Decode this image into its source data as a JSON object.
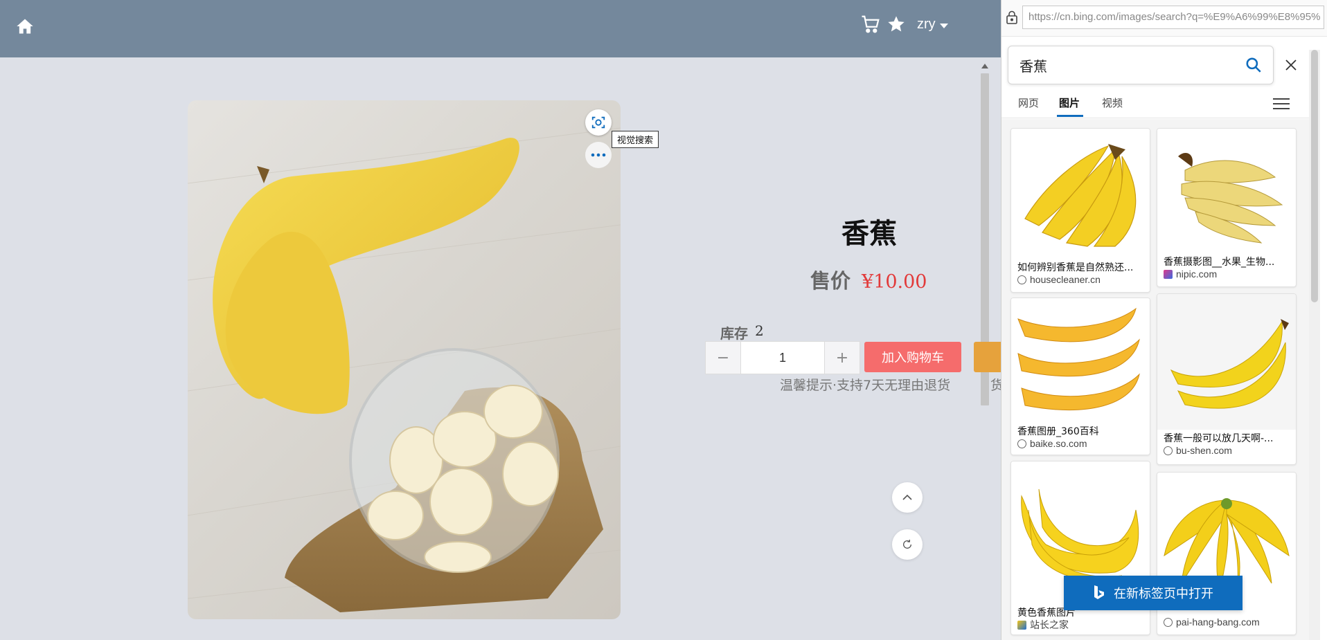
{
  "header": {
    "username": "zry"
  },
  "product": {
    "title": "香蕉",
    "price_label": "售价",
    "price_value": "¥10.00",
    "stock_label": "库存",
    "stock_value": "2",
    "quantity": "1",
    "qty_minus": "−",
    "qty_plus": "+",
    "add_to_cart_label": "加入购物车",
    "tip": "温馨提示·支持7天无理由退货",
    "tip_overflow": "货"
  },
  "image_overlay": {
    "tooltip": "视觉搜索"
  },
  "side_panel": {
    "url": "https://cn.bing.com/images/search?q=%E9%A6%99%E8%95%",
    "search_value": "香蕉",
    "tabs": [
      "网页",
      "图片",
      "视频"
    ],
    "active_tab": 1,
    "results": [
      {
        "title": "如何辨别香蕉是自然熟还...",
        "source": "housecleaner.cn",
        "favicon": "globe"
      },
      {
        "title": "香蕉摄影图__水果_生物...",
        "source": "nipic.com",
        "favicon": "nipic"
      },
      {
        "title": "香蕉图册_360百科",
        "source": "baike.so.com",
        "favicon": "globe"
      },
      {
        "title": "香蕉一般可以放几天啊-...",
        "source": "bu-shen.com",
        "favicon": "globe"
      },
      {
        "title": "黄色香蕉图片",
        "source": "站长之家",
        "favicon": "chinaz"
      },
      {
        "title": "",
        "source": "pai-hang-bang.com",
        "favicon": "globe"
      }
    ],
    "open_new_tab_label": "在新标签页中打开"
  },
  "colors": {
    "topbar": "#74889c",
    "price": "#e23a3a",
    "add_to_cart": "#f56c6c",
    "bing_blue": "#0f6cbd"
  }
}
